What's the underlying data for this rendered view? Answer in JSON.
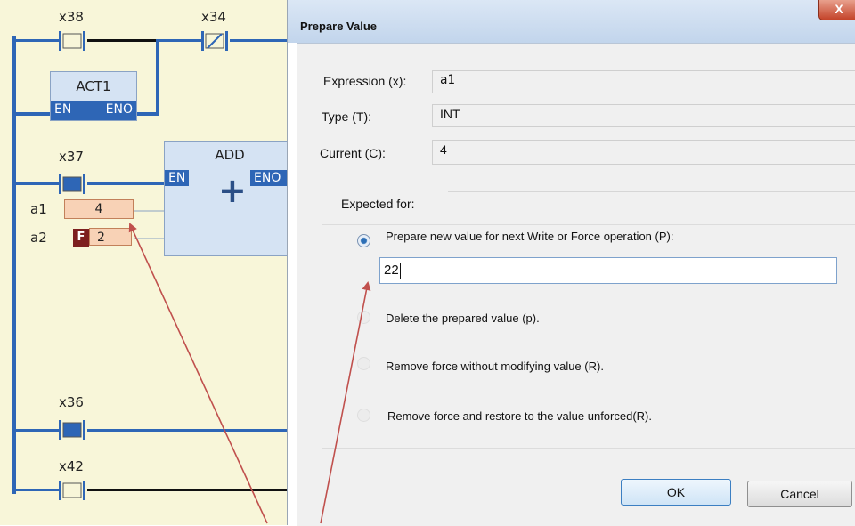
{
  "ladder": {
    "contacts": {
      "x38": "x38",
      "x34": "x34",
      "x37": "x37",
      "x36": "x36",
      "x42": "x42"
    },
    "act_block": {
      "title": "ACT1",
      "en": "EN",
      "eno": "ENO"
    },
    "add_block": {
      "title": "ADD",
      "en": "EN",
      "eno": "ENO",
      "symbol": "+"
    },
    "vars": {
      "a1": {
        "name": "a1",
        "value": "4"
      },
      "a2": {
        "name": "a2",
        "value": "2",
        "force_tag": "F"
      }
    }
  },
  "dialog": {
    "title": "Prepare Value",
    "close": "X",
    "expression_label": "Expression (x):",
    "expression_value": "a1",
    "type_label": "Type (T):",
    "type_value": "INT",
    "current_label": "Current (C):",
    "current_value": "4",
    "expected_label": "Expected for:",
    "options": [
      "Prepare new value for next Write or Force operation (P):",
      "Delete the prepared value (p).",
      "Remove force without modifying value (R).",
      "Remove force and restore to the value unforced(R)."
    ],
    "input_value": "22",
    "ok": "OK",
    "cancel": "Cancel"
  },
  "colors": {
    "rail": "#2e66b6",
    "arrow": "#c0504d",
    "ladder_bg": "#f8f6d9"
  }
}
